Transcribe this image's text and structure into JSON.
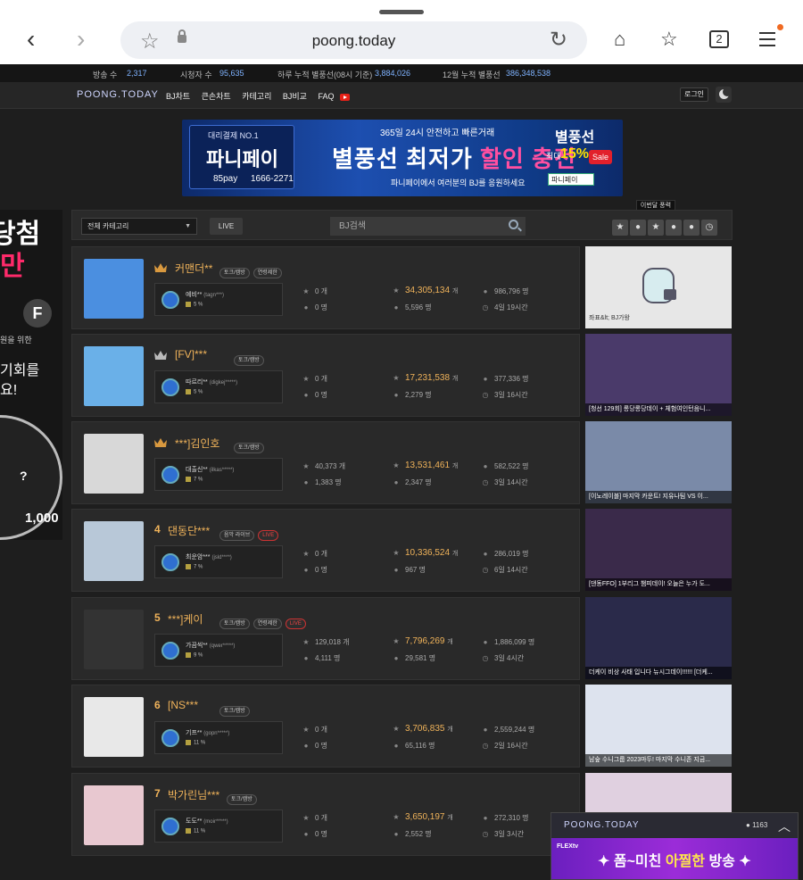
{
  "browser": {
    "url": "poong.today",
    "tab_count": "2"
  },
  "stats": {
    "broadcasts_label": "방송 수",
    "broadcasts": "2,317",
    "viewers_label": "시청자 수",
    "viewers": "95,635",
    "daily_label": "하루 누적 별풍선(08시 기준)",
    "daily": "3,884,026",
    "monthly_label": "12월 누적 별풍선",
    "monthly": "386,348,538"
  },
  "nav": {
    "logo": "POONG.TODAY",
    "links": [
      "BJ차트",
      "큰손차트",
      "카테고리",
      "BJ비교",
      "FAQ"
    ],
    "login": "로그인"
  },
  "banner": {
    "tag": "대리결제 NO.1",
    "brand": "파니페이",
    "handle": "85pay",
    "phone": "1666-2271",
    "headline_top": "365일 24시 안전하고 빠른거래",
    "headline_a": "별풍선 최저가",
    "headline_b": "할인 충전",
    "sub": "파니페이에서 여러분의 BJ를 응원하세요",
    "right_title": "별풍선",
    "right_max": "최대",
    "right_pct": "15%",
    "right_sale": "Sale",
    "right_select": "파니페이"
  },
  "filters": {
    "category": "전체 카테고리",
    "live": "LIVE",
    "search_placeholder": "BJ검색",
    "tooltip": "이번달 풍력"
  },
  "left_ad": {
    "line1": "당첨",
    "line2": "-만",
    "small1": "원을 위한",
    "small2": "",
    "mid1": "기회를",
    "mid2": "요!",
    "q": "?",
    "num": "1,000"
  },
  "rows": [
    {
      "rank": "",
      "name": "커맨더**",
      "tags": [
        "토크/캠방",
        "연령제한"
      ],
      "live": false,
      "fan": "예비**",
      "fan_id": "(tagn***)",
      "fan_pct": "5 %",
      "s1": "0 개",
      "s2": "0 명",
      "s3": "34,305,134",
      "s4": "5,596 명",
      "s5": "986,796 명",
      "s6": "4일 19시간",
      "thumb": "좌표&lt; BJ가왕"
    },
    {
      "rank": "",
      "name": "[FV]***",
      "tags": [
        "토크/캠방"
      ],
      "live": false,
      "fan": "따르리**",
      "fan_id": "(digkej*****)",
      "fan_pct": "5 %",
      "s1": "0 개",
      "s2": "0 명",
      "s3": "17,231,538",
      "s4": "2,279 명",
      "s5": "377,336 명",
      "s6": "3일 16시간",
      "thumb": "[청선 129회] 롱당롱당데이 + 체험여인턴음니..."
    },
    {
      "rank": "",
      "name": "***]김인호",
      "tags": [
        "토크/캠방"
      ],
      "live": false,
      "fan": "대출신**",
      "fan_id": "(ilkas*****)",
      "fan_pct": "7 %",
      "s1": "40,373 개",
      "s2": "1,383 명",
      "s3": "13,531,461",
      "s4": "2,347 명",
      "s5": "582,522 명",
      "s6": "3일 14시간",
      "thumb": "[이노레이블] 마지막 카운트! 지유나팀 VS 이..."
    },
    {
      "rank": "4",
      "name": "댄동단***",
      "tags": [
        "음악 라이브"
      ],
      "live": true,
      "fan": "최운암***",
      "fan_id": "(jsld****)",
      "fan_pct": "7 %",
      "s1": "0 개",
      "s2": "0 명",
      "s3": "10,336,524",
      "s4": "967 명",
      "s5": "286,019 명",
      "s6": "6일 14시간",
      "thumb": "[댄동FFO] 1부리그 챔피데이! 오늘은 누가 도..."
    },
    {
      "rank": "5",
      "name": "***]케이",
      "tags": [
        "토크/캠방",
        "연령제한"
      ],
      "live": true,
      "fan": "가끔씩**",
      "fan_id": "(qwer*****)",
      "fan_pct": "9 %",
      "s1": "129,018 개",
      "s2": "4,111 명",
      "s3": "7,796,269",
      "s4": "29,581 명",
      "s5": "1,886,099 명",
      "s6": "3일 4시간",
      "thumb": "더케이 비상 사태 입니다 뉴시그데이!!!!!! [더케..."
    },
    {
      "rank": "6",
      "name": "[NS***",
      "tags": [
        "토크/캠방"
      ],
      "live": false,
      "fan": "기프**",
      "fan_id": "(gopn*****)",
      "fan_pct": "11 %",
      "s1": "0 개",
      "s2": "0 명",
      "s3": "3,706,835",
      "s4": "65,116 명",
      "s5": "2,559,244 명",
      "s6": "2일 16시간",
      "thumb": "남숲 수니그룹 2023마두! 마지막 수니존 지금..."
    },
    {
      "rank": "7",
      "name": "박가린님***",
      "tags": [
        "토크/캠방"
      ],
      "live": false,
      "fan": "도도**",
      "fan_id": "(moir*****)",
      "fan_pct": "11 %",
      "s1": "0 개",
      "s2": "0 명",
      "s3": "3,650,197",
      "s4": "2,552 명",
      "s5": "272,310 명",
      "s6": "3일 3시간",
      "thumb": ""
    }
  ],
  "unit_gae": "개",
  "floating": {
    "logo": "POONG.TODAY",
    "count": "1163",
    "flex": "FLEXtv",
    "promo_a": "✦ 폼~미친",
    "promo_b": "아찔한",
    "promo_c": "방송 ✦"
  },
  "colors": {
    "accent": "#f0b35a",
    "link": "#7fb3ff",
    "live": "#e44444",
    "bg": "#1e1e1e"
  }
}
